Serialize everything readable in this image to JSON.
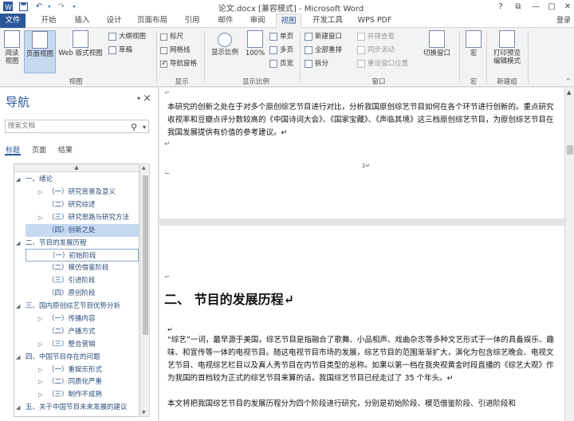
{
  "window": {
    "title": "论文.docx [兼容模式] - Microsoft Word",
    "help": "?",
    "restore": "⧉",
    "minimize": "—",
    "maximize": "□",
    "close": "✕",
    "login": "登录"
  },
  "quick_access": {
    "undo": "↶",
    "redo": "↷"
  },
  "tabs": [
    "文件",
    "开始",
    "插入",
    "设计",
    "页面布局",
    "引用",
    "邮件",
    "审阅",
    "视图",
    "开发工具",
    "WPS PDF"
  ],
  "ribbon": {
    "views": {
      "read_mode": "阅读视图",
      "print_layout": "页面视图",
      "web_layout": "Web 版式视图",
      "outline": "大纲视图",
      "draft": "草稿",
      "group_label": "视图"
    },
    "show": {
      "ruler": "标尺",
      "gridlines": "网格线",
      "nav_pane": "导航窗格",
      "group_label": "显示"
    },
    "zoom": {
      "zoom": "显示比例",
      "hundred": "100%",
      "one_page": "单页",
      "multi_page": "多页",
      "page_width": "页宽",
      "group_label": "显示比例"
    },
    "window": {
      "new_window": "新建窗口",
      "arrange_all": "全部重排",
      "split": "拆分",
      "side_by_side": "并排查看",
      "sync_scroll": "同步滚动",
      "reset_position": "重设窗口位置",
      "switch_windows": "切换窗口",
      "group_label": "窗口"
    },
    "macros": {
      "macros": "宏",
      "group_label": "宏"
    },
    "new_group": {
      "print_preview": "打印预览编辑模式",
      "group_label": "新建组"
    }
  },
  "nav": {
    "title": "导航",
    "search_placeholder": "搜索文档",
    "tabs": [
      "标题",
      "页面",
      "结果"
    ],
    "tree": [
      {
        "label": "一、绪论",
        "level": 1,
        "expanded": true
      },
      {
        "label": "（一）研究背景及意义",
        "level": 2,
        "expanded": false
      },
      {
        "label": "（二）研究综述",
        "level": 2,
        "expanded": null
      },
      {
        "label": "（三）研究思路与研究方法",
        "level": 2,
        "expanded": false
      },
      {
        "label": "（四）创新之处",
        "level": 2,
        "expanded": null,
        "selected": true
      },
      {
        "label": "二、节目的发展历程",
        "level": 1,
        "expanded": true
      },
      {
        "label": "（一）初始阶段",
        "level": 2,
        "expanded": null,
        "hover": true
      },
      {
        "label": "（二）模仿借鉴阶段",
        "level": 2,
        "expanded": null
      },
      {
        "label": "（三）引进阶段",
        "level": 2,
        "expanded": null
      },
      {
        "label": "（四）原创阶段",
        "level": 2,
        "expanded": null
      },
      {
        "label": "三、国内原创综艺节目优势分析",
        "level": 1,
        "expanded": true
      },
      {
        "label": "（一）传播内容",
        "level": 2,
        "expanded": false
      },
      {
        "label": "（二）产播方式",
        "level": 2,
        "expanded": null
      },
      {
        "label": "（三）整合营销",
        "level": 2,
        "expanded": false
      },
      {
        "label": "四、中国节目存在的问题",
        "level": 1,
        "expanded": true
      },
      {
        "label": "（一）重娱乐形式",
        "level": 2,
        "expanded": false
      },
      {
        "label": "（二）同质化严重",
        "level": 2,
        "expanded": false
      },
      {
        "label": "（三）制作不成熟",
        "level": 2,
        "expanded": false
      },
      {
        "label": "五、关于中国节目未来发展的建议",
        "level": 1,
        "expanded": true
      }
    ]
  },
  "document": {
    "page1_para": "本研究的创新之处在于对多个原创综艺节目进行对比，分析我国原创综艺节目如何在各个环节进行创新的。重点研究收视率和豆瓣点评分数较高的《中国诗词大会》、《国家宝藏》、《声临其境》这三档原创综艺节目，为原创综艺节目在我国发展提供有价值的参考建议。↵",
    "page_number": "2↵",
    "heading": "二、 节目的发展历程↵",
    "para1": "“综艺”一词，最早源于美国，综艺节目是指融合了歌舞、小品相声、戏曲杂志等多种文艺形式于一体的具备娱乐、趣味、和宣传等一体的电视节目。随这电视节目市场的发展，综艺节目的范围渐渐扩大，演化为包含综艺晚会、电视文艺节目、电视综艺栏目以及真人秀节目在内节目类型的总称。如果以第一档在我央视黄金时段直播的《综艺大观》作为我国的首档较为正式的综艺节目来算的话，我国综艺节目已经走过了 35 个年头。↵",
    "para2": "本文将把我国综艺节目的发展历程分为四个阶段进行研究，分别是初始阶段、模范借鉴阶段、引进阶段和"
  }
}
